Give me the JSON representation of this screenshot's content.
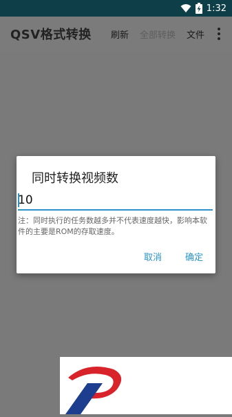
{
  "status_bar": {
    "time": "1:32",
    "icons": [
      "wifi-icon",
      "battery-charging-icon"
    ]
  },
  "app_bar": {
    "title": "QSV格式转换",
    "actions": [
      {
        "label": "刷新",
        "enabled": true
      },
      {
        "label": "全部转换",
        "enabled": false
      },
      {
        "label": "文件",
        "enabled": true
      }
    ],
    "overflow_icon": "more-vert-icon"
  },
  "dialog": {
    "title": "同时转换视频数",
    "input_value": "10",
    "note": "注：同时执行的任务数越多并不代表速度越快，影响本软件的主要是ROM的存取速度。",
    "cancel_label": "取消",
    "ok_label": "确定"
  },
  "colors": {
    "accent": "#2b94c8",
    "status_bar": "#0e3e48",
    "scrim": "#7a7a7a"
  }
}
